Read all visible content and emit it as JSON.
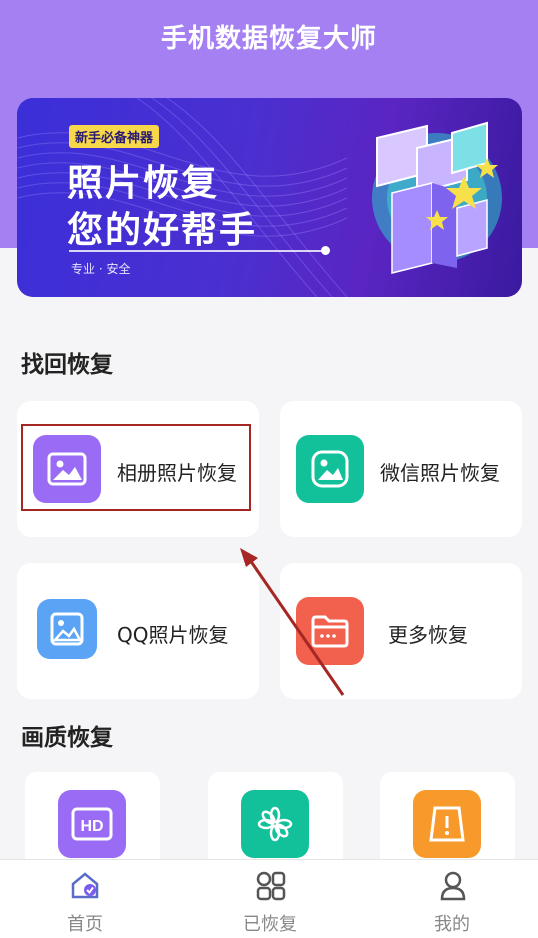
{
  "app": {
    "title": "手机数据恢复大师"
  },
  "banner": {
    "tag": "新手必备神器",
    "line1": "照片恢复",
    "line2": "您的好帮手",
    "subtitle": "专业 · 安全"
  },
  "sections": {
    "recover_title": "找回恢复",
    "quality_title": "画质恢复"
  },
  "recover_cards": [
    {
      "label": "相册照片恢复",
      "icon": "image-icon",
      "color": "#9a6cf6"
    },
    {
      "label": "微信照片恢复",
      "icon": "image-icon",
      "color": "#12c19a"
    },
    {
      "label": "QQ照片恢复",
      "icon": "image-icon",
      "color": "#5aa3f5"
    },
    {
      "label": "更多恢复",
      "icon": "folder-icon",
      "color": "#f2614e"
    }
  ],
  "quality_cards": [
    {
      "icon": "hd-icon",
      "icon_text": "HD",
      "color": "#9a6cf6"
    },
    {
      "icon": "flower-icon",
      "color": "#12c19a"
    },
    {
      "icon": "document-alert-icon",
      "color": "#f79a2b"
    }
  ],
  "tabbar": {
    "items": [
      {
        "label": "首页",
        "icon": "home-icon",
        "active": true
      },
      {
        "label": "已恢复",
        "icon": "grid-icon"
      },
      {
        "label": "我的",
        "icon": "user-icon"
      }
    ]
  },
  "colors": {
    "header": "#a580f3",
    "highlight_border": "#a52622",
    "arrow": "#a52622"
  }
}
